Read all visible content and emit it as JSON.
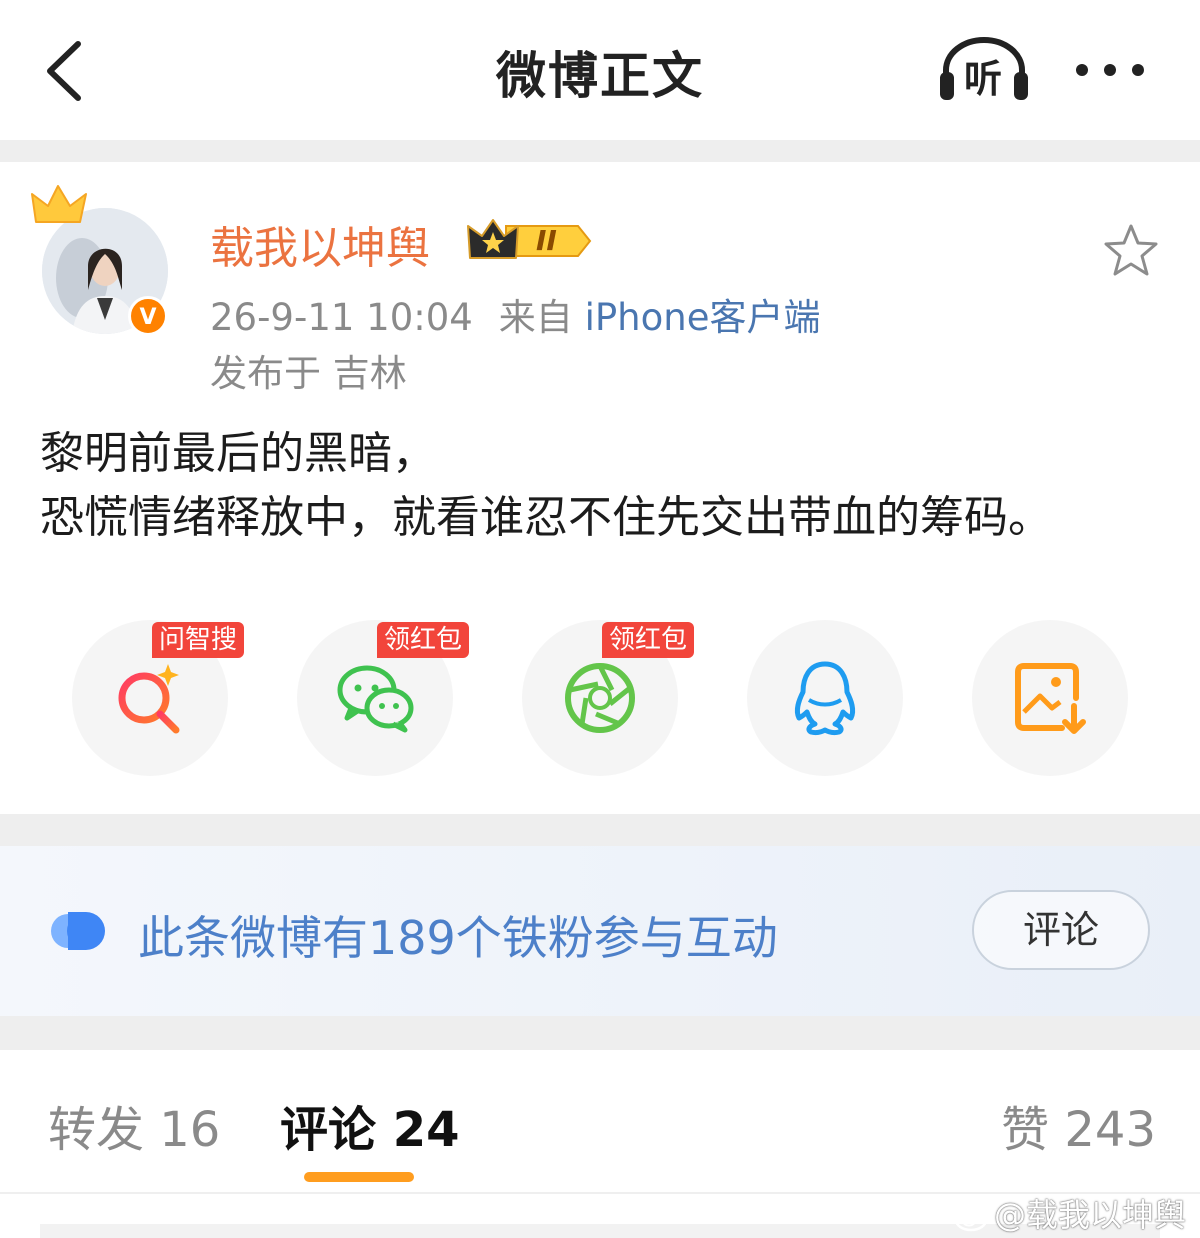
{
  "header": {
    "title": "微博正文",
    "back_icon": "chevron-left-icon",
    "listen_label": "听",
    "more_icon": "more-dots-icon"
  },
  "post": {
    "author": "载我以坤舆",
    "member_level": "II",
    "timestamp": "26-9-11 10:04",
    "source_prefix": "来自",
    "source": "iPhone客户端",
    "location": "发布于 吉林",
    "verified_mark": "V",
    "text_lines": [
      "黎明前最后的黑暗，",
      "恐慌情绪释放中，就看谁忍不住先交出带血的筹码。"
    ]
  },
  "share_row": [
    {
      "name": "ai-search",
      "icon": "ai-search-icon",
      "tag": "问智搜"
    },
    {
      "name": "wechat",
      "icon": "wechat-icon",
      "tag": "领红包"
    },
    {
      "name": "wechat-moments",
      "icon": "moments-icon",
      "tag": "领红包"
    },
    {
      "name": "qq",
      "icon": "qq-icon",
      "tag": ""
    },
    {
      "name": "save-image",
      "icon": "save-image-icon",
      "tag": ""
    }
  ],
  "fans_banner": {
    "text": "此条微博有189个铁粉参与互动",
    "button": "评论"
  },
  "tabs": {
    "repost": "转发 16",
    "comment": "评论 24",
    "like": "赞 243"
  },
  "watermark": "@载我以坤舆",
  "colors": {
    "accent": "#ff8200",
    "username": "#eb7340",
    "link": "#4a76b0",
    "tab_indicator": "#ff9d1f",
    "red_tag": "#f2453b"
  }
}
